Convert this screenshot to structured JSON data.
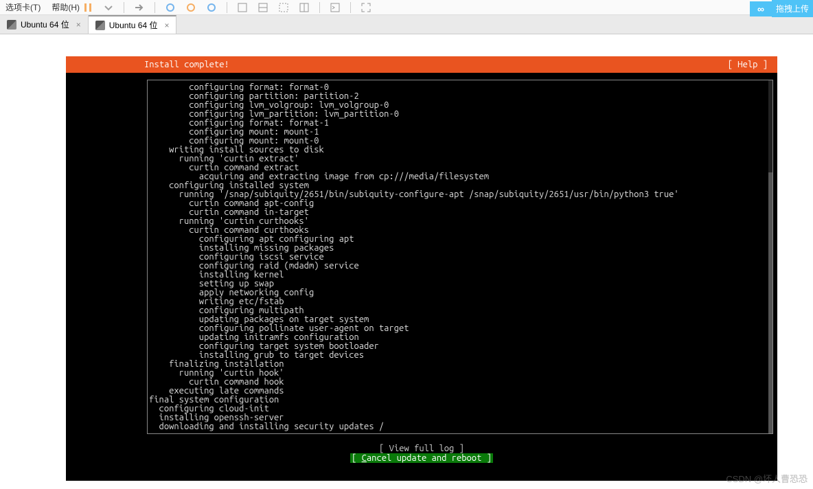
{
  "menu": {
    "tabs_menu": "选项卡(T)",
    "help_menu": "帮助(H)"
  },
  "corner": {
    "label": "拖拽上传"
  },
  "tabs": [
    {
      "label": "Ubuntu 64 位",
      "active": false
    },
    {
      "label": "Ubuntu 64 位",
      "active": true
    }
  ],
  "terminal": {
    "title": "Install complete!",
    "help": "[ Help ]",
    "actions": {
      "view_log": "[ View full log        ]",
      "cancel_reboot_prefix": "[ ",
      "cancel_reboot_u": "C",
      "cancel_reboot_rest": "ancel update and reboot ]"
    },
    "log_lines": [
      "        configuring format: format-0",
      "        configuring partition: partition-2",
      "        configuring lvm_volgroup: lvm_volgroup-0",
      "        configuring lvm_partition: lvm_partition-0",
      "        configuring format: format-1",
      "        configuring mount: mount-1",
      "        configuring mount: mount-0",
      "    writing install sources to disk",
      "      running 'curtin extract'",
      "        curtin command extract",
      "          acquiring and extracting image from cp:///media/filesystem",
      "    configuring installed system",
      "      running '/snap/subiquity/2651/bin/subiquity-configure-apt /snap/subiquity/2651/usr/bin/python3 true'",
      "        curtin command apt-config",
      "        curtin command in-target",
      "      running 'curtin curthooks'",
      "        curtin command curthooks",
      "          configuring apt configuring apt",
      "          installing missing packages",
      "          configuring iscsi service",
      "          configuring raid (mdadm) service",
      "          installing kernel",
      "          setting up swap",
      "          apply networking config",
      "          writing etc/fstab",
      "          configuring multipath",
      "          updating packages on target system",
      "          configuring pollinate user-agent on target",
      "          updating initramfs configuration",
      "          configuring target system bootloader",
      "          installing grub to target devices",
      "    finalizing installation",
      "      running 'curtin hook'",
      "        curtin command hook",
      "    executing late commands",
      "final system configuration",
      "  configuring cloud-init",
      "  installing openssh-server",
      "  downloading and installing security updates /"
    ]
  },
  "watermark": "CSDN @坏人曹恐恐"
}
